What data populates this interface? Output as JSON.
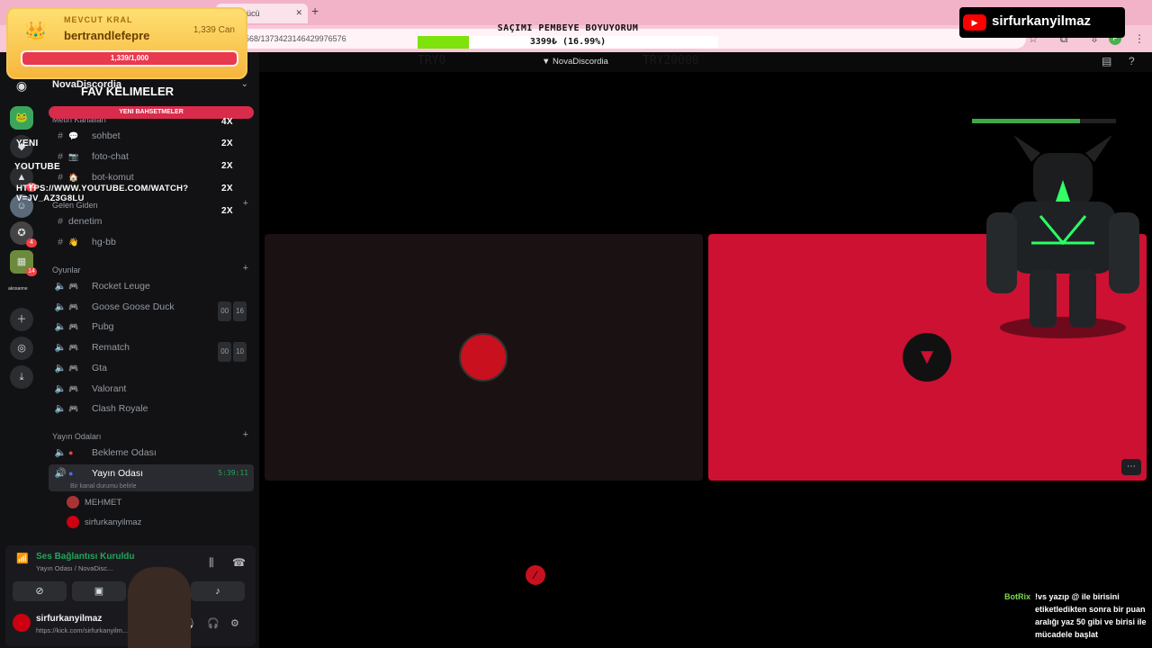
{
  "browser": {
    "tab_title": "ğkin Gücü",
    "new_tab_label": "+",
    "tab_close": "✕",
    "url_fragment": "568/1373423146429976576",
    "bookmark_icon": "star-icon",
    "extensions_icon": "puzzle-icon",
    "menu_icon": "kebab-icon",
    "profile_initial": "F"
  },
  "stream_overlay": {
    "king": {
      "heading": "MEVCUT KRAL",
      "user": "bertrandlefepre",
      "hp_text": "1,339 Can",
      "bar_text": "1,339/1,000"
    },
    "goal": {
      "title": "SAÇIMI PEMBEYE BOYUYORUM",
      "amount": "3399₺ (16.99%)",
      "left_label": "TRY0",
      "right_label": "TRY20000",
      "progress_fraction": 0.1699
    },
    "youtube_badge": {
      "handle": "sirfurkanyilmaz"
    },
    "fav_words": {
      "title": "FAV KELIMELER",
      "button": "YENI BAHSETMELER",
      "lines": [
        {
          "word": "",
          "mult": "4X"
        },
        {
          "word": "",
          "mult": "2X"
        },
        {
          "word": "YENI",
          "mult": "2X"
        },
        {
          "word": "YOUTUBE",
          "mult": ""
        },
        {
          "word": "HTTPS://WWW.YOUTUBE.COM/WATCH?V=JV_AZ3G8LU",
          "mult": "2X"
        },
        {
          "word": "",
          "mult": "2X"
        }
      ]
    },
    "chat": {
      "author": "BotRix",
      "message": "!vs yazıp @ ile birisini etiketledikten sonra bir puan aralığı yaz 50 gibi ve birisi ile mücadele başlat"
    },
    "monster_hp_fraction": 0.75
  },
  "discord": {
    "server_name": "NovaDiscordia",
    "topbar_title": "NovaDiscordia",
    "server_badges": [
      "10",
      "4",
      "14"
    ],
    "server_labels": {
      "small_text": "akosanne"
    },
    "categories": {
      "text": "Metin Kanalları",
      "gelen": "Gelen Giden",
      "oyunlar": "Oyunlar",
      "yayin": "Yayın Odaları"
    },
    "text_channels": [
      {
        "emoji": "💬",
        "name": "sohbet"
      },
      {
        "emoji": "📷",
        "name": "foto-chat"
      },
      {
        "emoji": "🏠",
        "name": "bot-komut"
      }
    ],
    "gelen_channels": [
      {
        "emoji": "",
        "name": "denetim"
      },
      {
        "emoji": "👋",
        "name": "hg-bb"
      }
    ],
    "game_channels": [
      {
        "name": "Rocket Leuge",
        "c1": "",
        "c2": ""
      },
      {
        "name": "Goose Goose Duck",
        "c1": "00",
        "c2": "16"
      },
      {
        "name": "Pubg",
        "c1": "",
        "c2": ""
      },
      {
        "name": "Rematch",
        "c1": "00",
        "c2": "10"
      },
      {
        "name": "Gta",
        "c1": "",
        "c2": ""
      },
      {
        "name": "Valorant",
        "c1": "",
        "c2": ""
      },
      {
        "name": "Clash Royale",
        "c1": "",
        "c2": ""
      }
    ],
    "stream_channels": [
      {
        "name": "Bekleme Odası"
      },
      {
        "name": "Yayın Odası",
        "timer": "5:39:11",
        "status": "Bir kanal durumu belirle"
      }
    ],
    "members": [
      "MEHMET",
      "sirfurkanyilmaz"
    ],
    "voice": {
      "status": "Ses Bağlantısı Kuruldu",
      "channel": "Yayın Odası / NovaDisc..."
    },
    "user": {
      "name": "sirfurkanyilmaz",
      "activity": "https://kick.com/sirfurkanyilm..."
    },
    "colors": {
      "accent": "#23a55a",
      "stream_tile": "#cc1133",
      "danger": "#f23f43"
    }
  }
}
